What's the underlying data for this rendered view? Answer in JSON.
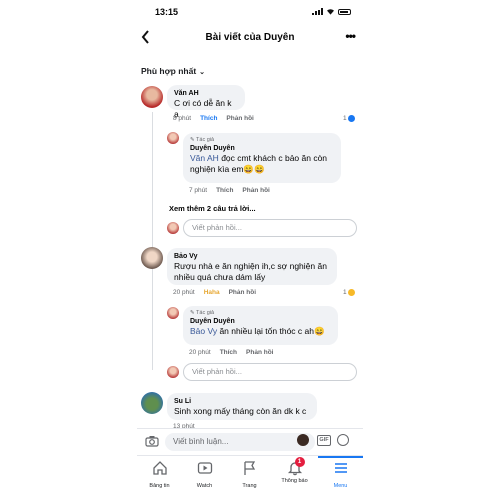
{
  "status_bar": {
    "time": "13:15"
  },
  "nav": {
    "title": "Bài viết của Duyên"
  },
  "sort_label": "Phù hợp nhất",
  "comments": [
    {
      "author": "Văn AH",
      "text": "C ơi có dễ ăn k ạ",
      "time": "8 phút",
      "like": "Thích",
      "reply": "Phản hồi",
      "reaction_count": "1"
    },
    {
      "badge": "Tác giả",
      "author": "Duyên Duyên",
      "mention": "Văn AH",
      "text": " đọc cmt khách c bảo ăn còn nghiện kìa em😄😄",
      "time": "7 phút",
      "like": "Thích",
      "reply": "Phản hồi"
    },
    {
      "more_replies": "Xem thêm 2 câu trả lời...",
      "reply_placeholder": "Viết phản hồi..."
    },
    {
      "author": "Bảo Vy",
      "text": "Rượu nhà e ăn nghiện ih,c sợ nghiện ăn nhiều quá chưa dám lấy",
      "time": "20 phút",
      "reaction_label": "Haha",
      "reply": "Phản hồi",
      "reaction_count": "1"
    },
    {
      "badge": "Tác giả",
      "author": "Duyên Duyên",
      "mention": "Bảo Vy",
      "text": " ăn nhiều lại tốn thóc c ah😄",
      "time": "20 phút",
      "like": "Thích",
      "reply": "Phản hồi"
    },
    {
      "reply_placeholder": "Viết phản hồi..."
    },
    {
      "author": "Su Li",
      "text": "Sinh xong mấy tháng còn ăn dk k c",
      "time": "13 phút"
    }
  ],
  "composer": {
    "placeholder": "Viết bình luận...",
    "gif": "GIF"
  },
  "tabs": [
    {
      "label": "Bảng tin",
      "icon": "home-icon"
    },
    {
      "label": "Watch",
      "icon": "watch-icon"
    },
    {
      "label": "Trang",
      "icon": "flag-icon"
    },
    {
      "label": "Thông báo",
      "icon": "bell-icon",
      "badge": "1"
    },
    {
      "label": "Menu",
      "icon": "menu-icon"
    }
  ],
  "colors": {
    "accent": "#1877f2",
    "haha": "#e7a833",
    "badge": "#e41e3f",
    "bubble": "#f0f2f5"
  }
}
